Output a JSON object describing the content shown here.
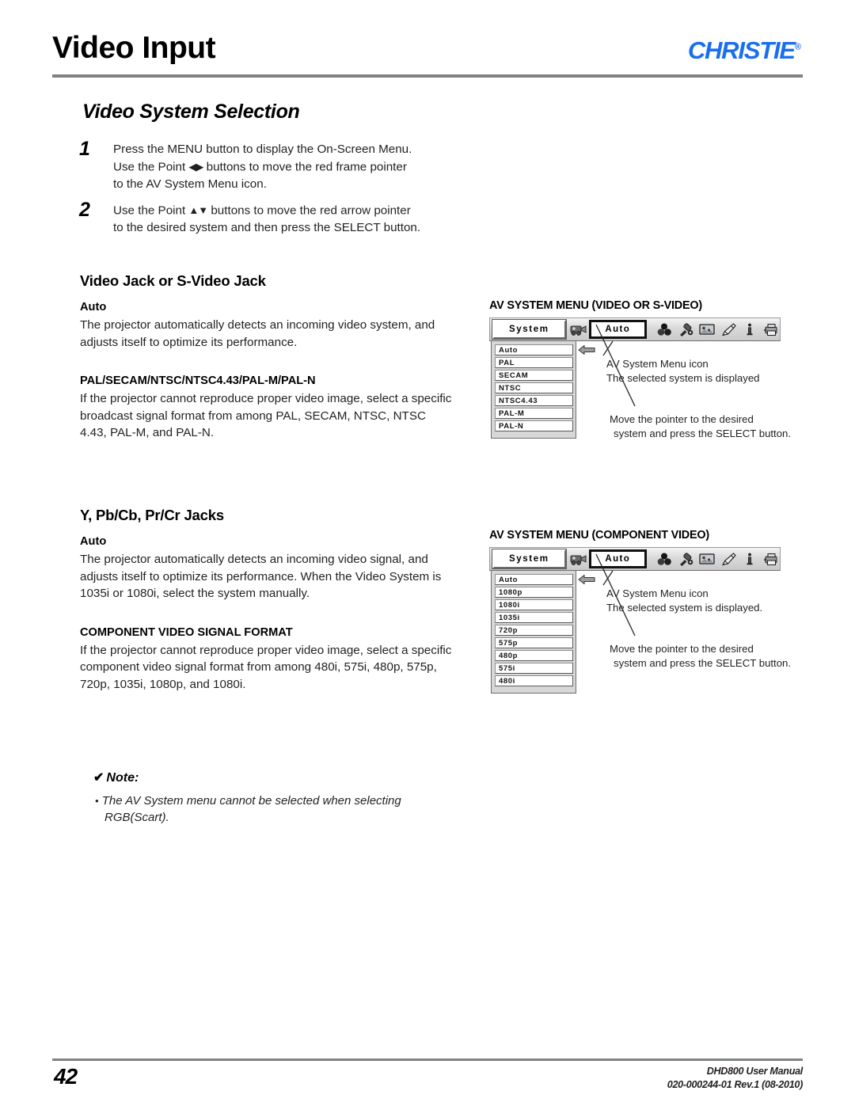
{
  "header": {
    "title": "Video Input",
    "brand": "CHRISTIE",
    "brand_mark": "®"
  },
  "section": {
    "title": "Video System Selection"
  },
  "steps": [
    {
      "number": "1",
      "line1": "Press the MENU button to display the On-Screen Menu.",
      "line2_pre": "Use the Point ",
      "line2_glyph": "◀▶",
      "line2_post": " buttons to move the red frame pointer",
      "line3": "to the AV System Menu icon."
    },
    {
      "number": "2",
      "line1_pre": "Use the Point ",
      "line1_glyph": "▲▼",
      "line1_post": " buttons to move the red arrow pointer",
      "line2": "to the desired system and then press the SELECT button."
    }
  ],
  "video_jack": {
    "heading": "Video Jack or S-Video Jack",
    "auto_term": "Auto",
    "auto_text": "The projector automatically detects an incoming video system, and adjusts itself to optimize its performance.",
    "format_term": "PAL/SECAM/NTSC/NTSC4.43/PAL-M/PAL-N",
    "format_text": "If the projector cannot reproduce proper video image, select a specific broadcast signal format from among PAL, SECAM, NTSC, NTSC 4.43, PAL-M, and PAL-N."
  },
  "component_jack": {
    "heading": "Y, Pb/Cb, Pr/Cr Jacks",
    "auto_term": "Auto",
    "auto_text": "The projector automatically detects an incoming video signal, and adjusts itself to optimize its performance. When the Video System is 1035i or 1080i, select the system manually.",
    "format_term": "COMPONENT VIDEO SIGNAL FORMAT",
    "format_text": "If the projector cannot reproduce proper video image, select a specific component video signal format from among 480i, 575i, 480p, 575p, 720p, 1035i, 1080p, and 1080i."
  },
  "note": {
    "check": "✔",
    "heading": "Note:",
    "bullet": "•",
    "item": "The AV System menu cannot be selected when selecting RGB(Scart)."
  },
  "figure_video": {
    "caption": "AV SYSTEM MENU (VIDEO OR S-VIDEO)",
    "tab_label": "System",
    "selected_value": "Auto",
    "menu_icons": [
      "video-camera-icon",
      "color-adjust-icon",
      "image-adjust-icon",
      "screen-icon",
      "pencil-icon",
      "information-icon",
      "setting-icon"
    ],
    "items": [
      "Auto",
      "PAL",
      "SECAM",
      "NTSC",
      "NTSC4.43",
      "PAL-M",
      "PAL-N"
    ],
    "pointer_item": "Auto",
    "callout_top_line1": "AV System Menu icon",
    "callout_top_line2": "The selected system is displayed",
    "callout_bottom_line1": "Move the pointer to the desired",
    "callout_bottom_line2": "system and press the SELECT button."
  },
  "figure_component": {
    "caption": "AV SYSTEM MENU (COMPONENT VIDEO)",
    "tab_label": "System",
    "selected_value": "Auto",
    "items": [
      "Auto",
      "1080p",
      "1080i",
      "1035i",
      "720p",
      "575p",
      "480p",
      "575i",
      "480i"
    ],
    "pointer_item": "Auto",
    "callout_top_line1": "AV System Menu icon",
    "callout_top_line2": "The selected system is displayed.",
    "callout_bottom_line1": "Move the pointer to the desired",
    "callout_bottom_line2": "system and press the SELECT button."
  },
  "footer": {
    "page_number": "42",
    "manual": "DHD800 User Manual",
    "doc_id": "020-000244-01 Rev.1 (08-2010)"
  },
  "colors": {
    "brand_blue": "#1a6ef0",
    "rule_gray": "#808184",
    "text": "#231f20"
  }
}
